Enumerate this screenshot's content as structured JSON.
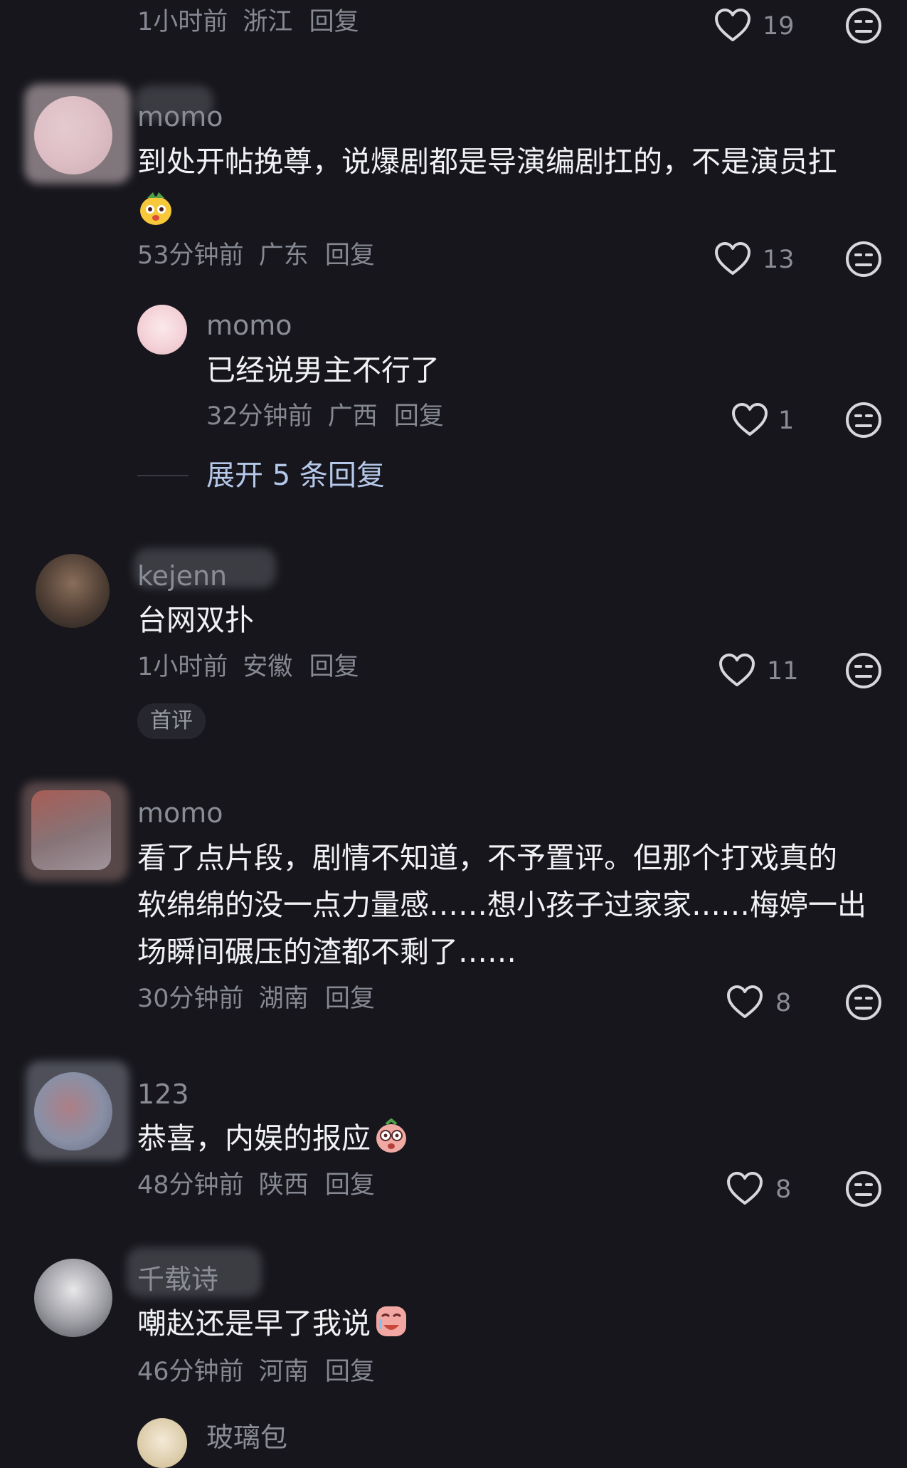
{
  "comments": [
    {
      "meta_time": "1小时前",
      "meta_region": "浙江",
      "meta_reply": "回复",
      "likes": "19"
    },
    {
      "username": "momo",
      "content": "到处开帖挽尊，说爆剧都是导演编剧扛的，不是演员扛",
      "meta_time": "53分钟前",
      "meta_region": "广东",
      "meta_reply": "回复",
      "likes": "13",
      "reply": {
        "username": "momo",
        "content": "已经说男主不行了",
        "meta_time": "32分钟前",
        "meta_region": "广西",
        "meta_reply": "回复",
        "likes": "1"
      },
      "expand_label": "展开 5 条回复"
    },
    {
      "username": "kejenn",
      "content": "台网双扑",
      "meta_time": "1小时前",
      "meta_region": "安徽",
      "meta_reply": "回复",
      "likes": "11",
      "badge": "首评"
    },
    {
      "username": "momo",
      "content_lines": [
        "看了点片段，剧情不知道，不予置评。但那个打戏真的",
        "软绵绵的没一点力量感……想小孩子过家家……梅婷一出",
        "场瞬间碾压的渣都不剩了……"
      ],
      "meta_time": "30分钟前",
      "meta_region": "湖南",
      "meta_reply": "回复",
      "likes": "8"
    },
    {
      "username": "123",
      "content": "恭喜，内娱的报应",
      "meta_time": "48分钟前",
      "meta_region": "陕西",
      "meta_reply": "回复",
      "likes": "8"
    },
    {
      "username": "千载诗",
      "content": "嘲赵还是早了我说",
      "meta_time": "46分钟前",
      "meta_region": "河南",
      "meta_reply": "回复"
    },
    {
      "username": "玻璃包"
    }
  ],
  "icons": {
    "like": "heart-outline-icon",
    "dislike": "meh-face-icon"
  },
  "colors": {
    "background": "#16161c",
    "text_primary": "#f1f2f4",
    "text_secondary": "#868892",
    "expand_link": "#b6c8ea"
  }
}
